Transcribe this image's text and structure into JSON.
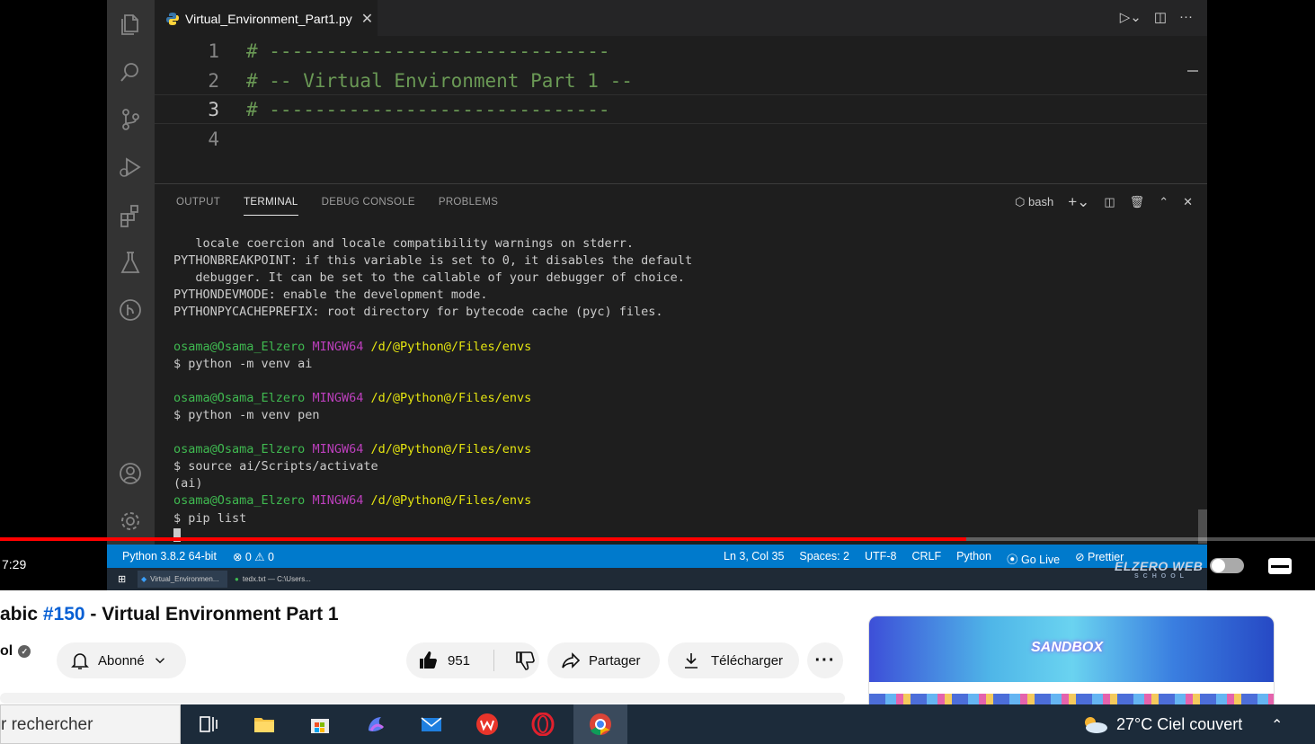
{
  "editor": {
    "tab_label": "Virtual_Environment_Part1.py",
    "lines": [
      {
        "num": "1",
        "text": "# ------------------------------"
      },
      {
        "num": "2",
        "text": "# -- Virtual Environment Part 1 --"
      },
      {
        "num": "3",
        "text": "# ------------------------------"
      },
      {
        "num": "4",
        "text": ""
      }
    ]
  },
  "panel": {
    "tabs": [
      "OUTPUT",
      "TERMINAL",
      "DEBUG CONSOLE",
      "PROBLEMS"
    ],
    "active_tab": "TERMINAL",
    "shell": "bash"
  },
  "terminal": {
    "intro": [
      "   locale coercion and locale compatibility warnings on stderr.",
      "PYTHONBREAKPOINT: if this variable is set to 0, it disables the default",
      "   debugger. It can be set to the callable of your debugger of choice.",
      "PYTHONDEVMODE: enable the development mode.",
      "PYTHONPYCACHEPREFIX: root directory for bytecode cache (pyc) files."
    ],
    "prompt_user": "osama@Osama_Elzero",
    "prompt_sys": "MINGW64",
    "prompt_path": "/d/@Python@/Files/envs",
    "cmd1": "$ python -m venv ai",
    "cmd2": "$ python -m venv pen",
    "cmd3": "$ source ai/Scripts/activate",
    "venv_marker": "(ai)",
    "cmd4": "$ pip list"
  },
  "statusbar": {
    "interpreter": "Python 3.8.2 64-bit",
    "errors": "⊗ 0 ⚠ 0",
    "position": "Ln 3, Col 35",
    "spaces": "Spaces: 2",
    "encoding": "UTF-8",
    "eol": "CRLF",
    "language": "Python",
    "golive": "Go Live",
    "prettier": "Prettier"
  },
  "inner_taskbar": {
    "item1": "Virtual_Environmen...",
    "item2": "tedx.txt — C:\\Users..."
  },
  "player": {
    "timecode": "7:29",
    "progress": 0.735,
    "watermark": "ELZERO WEB",
    "watermark_sub": "SCHOOL"
  },
  "video": {
    "title_prefix": "abic ",
    "title_hash": "#150",
    "title_rest": " - Virtual Environment Part 1",
    "channel": "ol",
    "subscribe_label": "Abonné",
    "likes": "951",
    "share_label": "Partager",
    "download_label": "Télécharger",
    "more_label": "···"
  },
  "ad": {
    "text": "SANDBOX"
  },
  "taskbar": {
    "search_text": "r rechercher",
    "weather": "27°C  Ciel couvert",
    "tray": "⌃"
  },
  "colors": {
    "statusbar": "#007acc",
    "comment": "#6a9955",
    "progress": "#ff0000",
    "link": "#065fd4"
  }
}
